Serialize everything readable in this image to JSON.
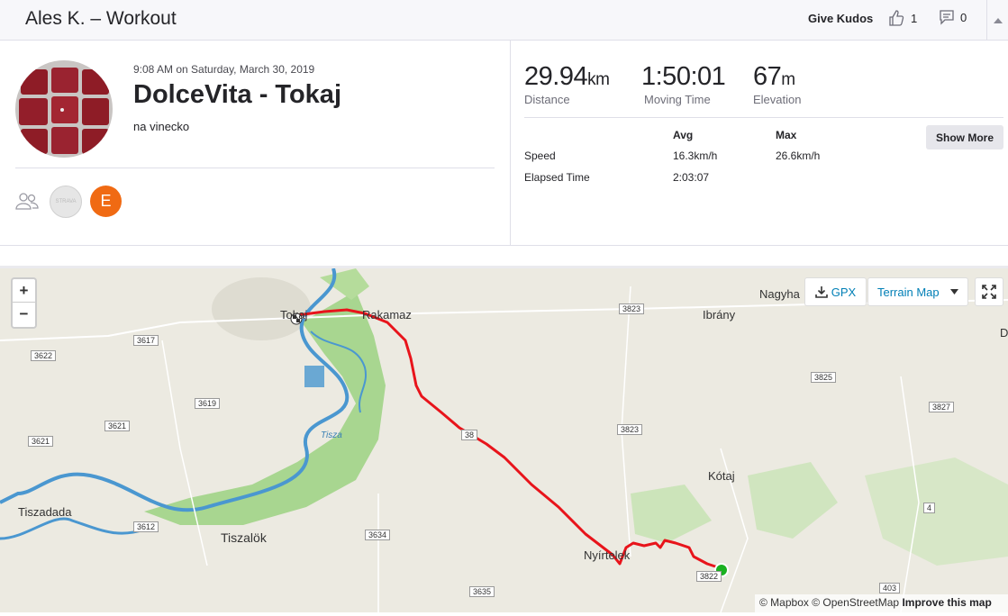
{
  "header": {
    "title": "Ales K. – Workout",
    "give_kudos": "Give Kudos",
    "kudos_count": "1",
    "comment_count": "0"
  },
  "activity": {
    "datetime": "9:08 AM on Saturday, March 30, 2019",
    "name": "DolceVita - Tokaj",
    "description": "na vinecko",
    "athlete_initial": "E",
    "club_badge_text": "STRAVA"
  },
  "stats": {
    "distance_value": "29.94",
    "distance_unit": "km",
    "distance_label": "Distance",
    "moving_time_value": "1:50:01",
    "moving_time_label": "Moving Time",
    "elevation_value": "67",
    "elevation_unit": "m",
    "elevation_label": "Elevation",
    "col_avg": "Avg",
    "col_max": "Max",
    "speed_label": "Speed",
    "speed_avg": "16.3km/h",
    "speed_max": "26.6km/h",
    "elapsed_label": "Elapsed Time",
    "elapsed_avg": "2:03:07",
    "show_more": "Show More"
  },
  "map": {
    "zoom_in": "+",
    "zoom_out": "−",
    "gpx_label": "GPX",
    "map_type": "Terrain Map",
    "places": [
      "Tokaj",
      "Rakamaz",
      "Nagyha",
      "Ibrány",
      "Kótaj",
      "Tiszadada",
      "Tiszalök",
      "Nyírtelek",
      "Tisza",
      "D"
    ],
    "roads": [
      "3617",
      "3622",
      "3619",
      "3621",
      "3621",
      "3612",
      "3634",
      "3635",
      "3823",
      "3823",
      "3825",
      "3827",
      "38",
      "3822",
      "4",
      "403"
    ],
    "attribution_mapbox": "© Mapbox",
    "attribution_osm": "© OpenStreetMap",
    "attribution_improve": "Improve this map",
    "colors": {
      "route": "#e8141b",
      "end_marker": "#1ab120",
      "river": "#3f8ec9",
      "forest": "#9bd17f",
      "brand": "#007fb6"
    }
  }
}
